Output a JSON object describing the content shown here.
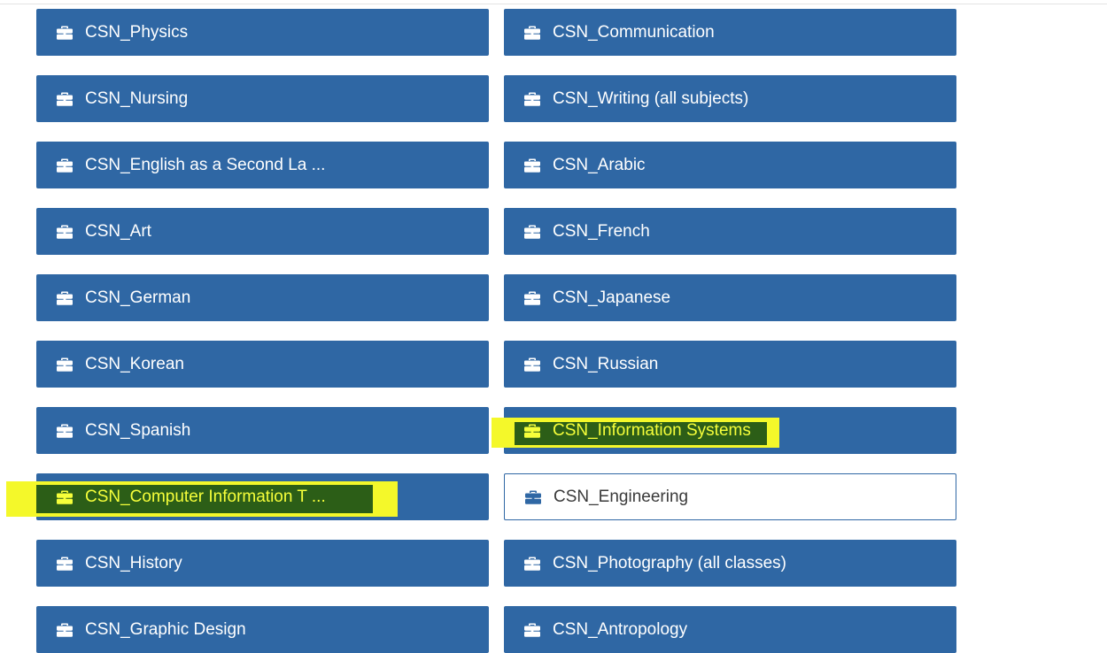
{
  "accent_color": "#2f67a4",
  "highlight_color": "#f4f82a",
  "tiles": [
    {
      "label": "CSN_Physics",
      "icon": "briefcase-icon"
    },
    {
      "label": "CSN_Communication",
      "icon": "briefcase-icon"
    },
    {
      "label": "CSN_Nursing",
      "icon": "briefcase-icon"
    },
    {
      "label": "CSN_Writing (all subjects)",
      "icon": "briefcase-icon"
    },
    {
      "label": "CSN_English as a Second La ...",
      "icon": "briefcase-icon"
    },
    {
      "label": "CSN_Arabic",
      "icon": "briefcase-icon"
    },
    {
      "label": "CSN_Art",
      "icon": "briefcase-icon"
    },
    {
      "label": "CSN_French",
      "icon": "briefcase-icon"
    },
    {
      "label": "CSN_German",
      "icon": "briefcase-icon"
    },
    {
      "label": "CSN_Japanese",
      "icon": "briefcase-icon"
    },
    {
      "label": "CSN_Korean",
      "icon": "briefcase-icon"
    },
    {
      "label": "CSN_Russian",
      "icon": "briefcase-icon"
    },
    {
      "label": "CSN_Spanish",
      "icon": "briefcase-icon"
    },
    {
      "label": "CSN_Information Systems",
      "icon": "briefcase-icon",
      "highlighted": true
    },
    {
      "label": "CSN_Computer Information T ...",
      "icon": "briefcase-icon",
      "highlighted": true
    },
    {
      "label": "CSN_Engineering",
      "icon": "briefcase-icon",
      "outlined": true
    },
    {
      "label": "CSN_History",
      "icon": "briefcase-icon"
    },
    {
      "label": "CSN_Photography (all classes)",
      "icon": "briefcase-icon"
    },
    {
      "label": "CSN_Graphic Design",
      "icon": "briefcase-icon"
    },
    {
      "label": "CSN_Antropology",
      "icon": "briefcase-icon"
    }
  ]
}
